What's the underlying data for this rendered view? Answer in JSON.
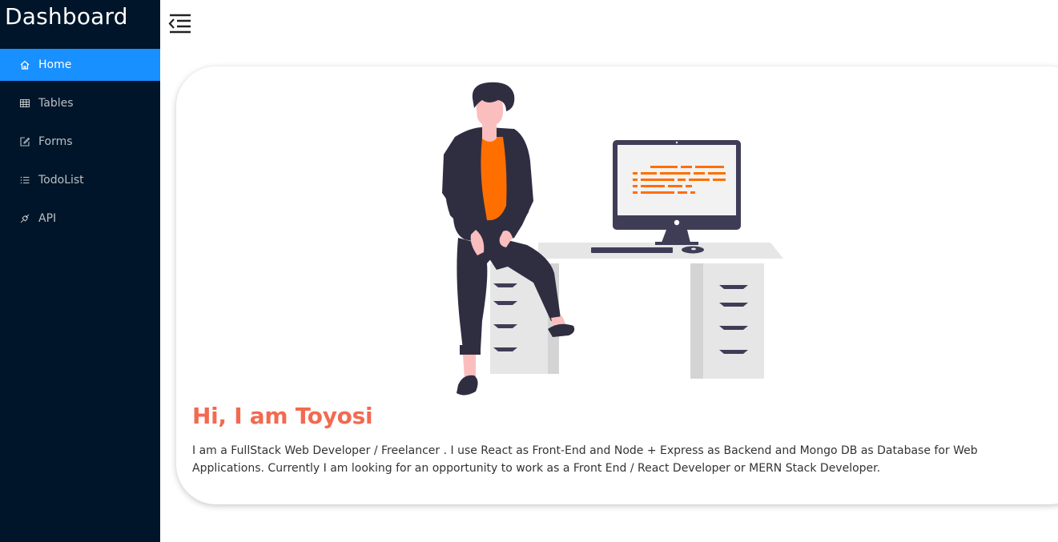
{
  "sidebar": {
    "title": "Dashboard",
    "items": [
      {
        "label": "Home",
        "icon": "home-icon",
        "active": true
      },
      {
        "label": "Tables",
        "icon": "table-icon",
        "active": false
      },
      {
        "label": "Forms",
        "icon": "edit-icon",
        "active": false
      },
      {
        "label": "TodoList",
        "icon": "list-icon",
        "active": false
      },
      {
        "label": "API",
        "icon": "api-icon",
        "active": false
      }
    ]
  },
  "header": {
    "toggle_icon": "menu-fold-icon"
  },
  "main": {
    "headline": "Hi, I am Toyosi",
    "bio": "I am a FullStack Web Developer / Freelancer . I use React as Front-End and Node + Express as Backend and Mongo DB as Database for Web Applications. Currently I am looking for an opportunity to work as a Front End / React Developer or MERN Stack Developer."
  },
  "colors": {
    "sidebar_bg": "#001529",
    "active_item": "#1890ff",
    "headline": "#f26a50",
    "accent_orange": "#ff6f00",
    "dark_figure": "#2f2e41"
  }
}
